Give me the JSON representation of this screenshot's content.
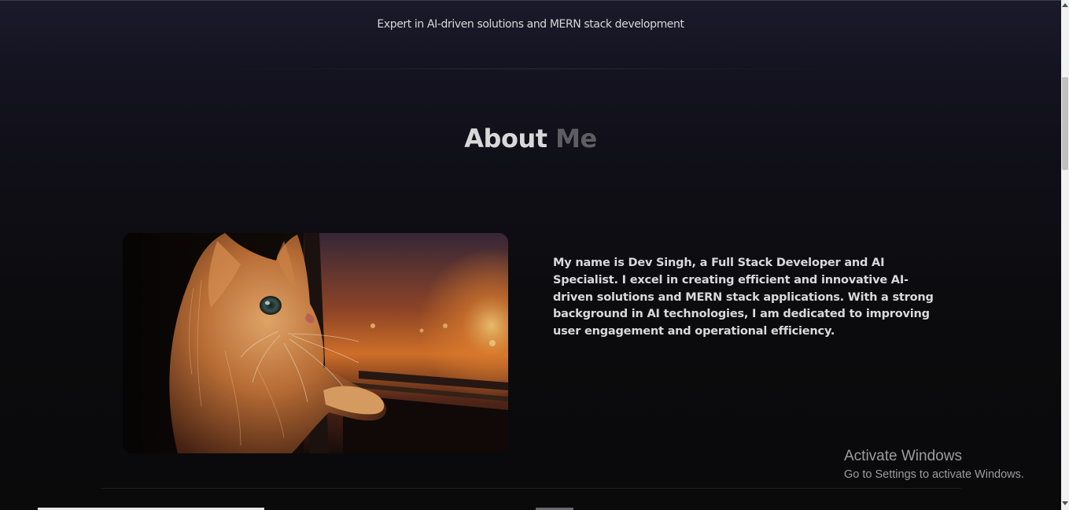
{
  "hero": {
    "tagline": "Expert in AI-driven solutions and MERN stack development"
  },
  "about": {
    "heading_part1": "About",
    "heading_part2": "Me",
    "bio": "My name is Dev Singh, a Full Stack Developer and AI Specialist. I excel in creating efficient and innovative AI-driven solutions and MERN stack applications. With a strong background in AI technologies, I am dedicated to improving user engagement and operational efficiency."
  },
  "watermark": {
    "title": "Activate Windows",
    "subtitle": "Go to Settings to activate Windows."
  },
  "colors": {
    "heading_primary": "#d8d8d8",
    "heading_muted": "#5e5e62",
    "background": "#0b0b0d"
  }
}
